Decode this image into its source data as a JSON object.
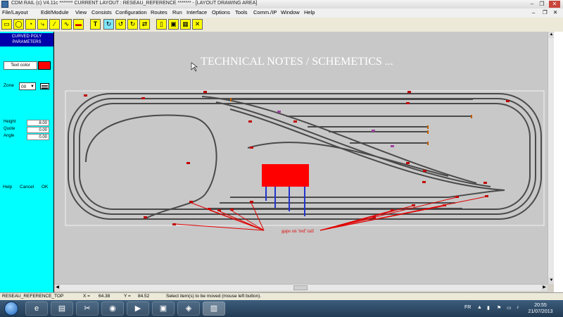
{
  "window": {
    "title": "CDM RAIL (c) V4.11c       ******* CURRENT LAYOUT : RESEAU_REFERENCE ******* - [LAYOUT DRAWING AREA]",
    "minimize_glyph": "–",
    "restore_glyph": "❐",
    "close_glyph": "✕"
  },
  "menu": [
    "File/Layout",
    "Edit/Module",
    "View",
    "Consists",
    "Configuration",
    "Routes",
    "Run",
    "Interface",
    "Options",
    "Tools",
    "Comm./IP",
    "Window",
    "Help"
  ],
  "menu_window_controls": [
    "–",
    "❐",
    "✕"
  ],
  "toolbar": {
    "tools": [
      {
        "icon": "rectangle-icon",
        "glyph": "▭"
      },
      {
        "icon": "circle-icon",
        "glyph": "◯"
      },
      {
        "icon": "curve-icon",
        "glyph": "◔"
      },
      {
        "icon": "turnout-icon",
        "glyph": "⤷"
      },
      {
        "icon": "line-icon",
        "glyph": "∕"
      },
      {
        "icon": "wave-icon",
        "glyph": "∿"
      },
      {
        "icon": "signal-icon",
        "glyph": "▬"
      },
      {
        "icon": "text-icon",
        "glyph": "T"
      },
      {
        "icon": "rotate-icon",
        "glyph": "↻"
      },
      {
        "icon": "rotate-left-icon",
        "glyph": "↺"
      },
      {
        "icon": "rotate-right-icon",
        "glyph": "↻"
      },
      {
        "icon": "flip-icon",
        "glyph": "⇄"
      },
      {
        "icon": "column-icon",
        "glyph": "▯"
      },
      {
        "icon": "block-icon",
        "glyph": "▣"
      },
      {
        "icon": "grid-icon",
        "glyph": "▦"
      },
      {
        "icon": "switch-icon",
        "glyph": "✕"
      }
    ]
  },
  "panel": {
    "title_line1": "CURVED POLY",
    "title_line2": "PARAMETERS",
    "text_color_label": "Text color",
    "text_color_value": "#ff0000",
    "zone_label": "Zone",
    "zone_value": "00",
    "height_label": "Height",
    "height_value": "8.00",
    "quote_label": "Quote",
    "quote_value": "0.00",
    "angle_label": "Angle",
    "angle_value": "0.00",
    "help_label": "Help",
    "cancel_label": "Cancel",
    "ok_label": "OK"
  },
  "canvas": {
    "heading": "TECHNICAL NOTES / SCHEMETICS ...",
    "annotation": "gaps on 'red' rail"
  },
  "colors": {
    "track": "#4a4a4a",
    "red_rail": "#e00000",
    "block": "#ff0000",
    "canvas": "#c8c8c8"
  },
  "status": {
    "layout": "RESEAU_REFERENCE_TOP",
    "x_label": "X =",
    "x_value": "64.38",
    "y_label": "Y =",
    "y_value": "84.52",
    "message": "Select item(s) to be moved (mouse left button)."
  },
  "taskbar": {
    "lang": "FR",
    "time": "20:55",
    "date": "21/07/2013"
  }
}
